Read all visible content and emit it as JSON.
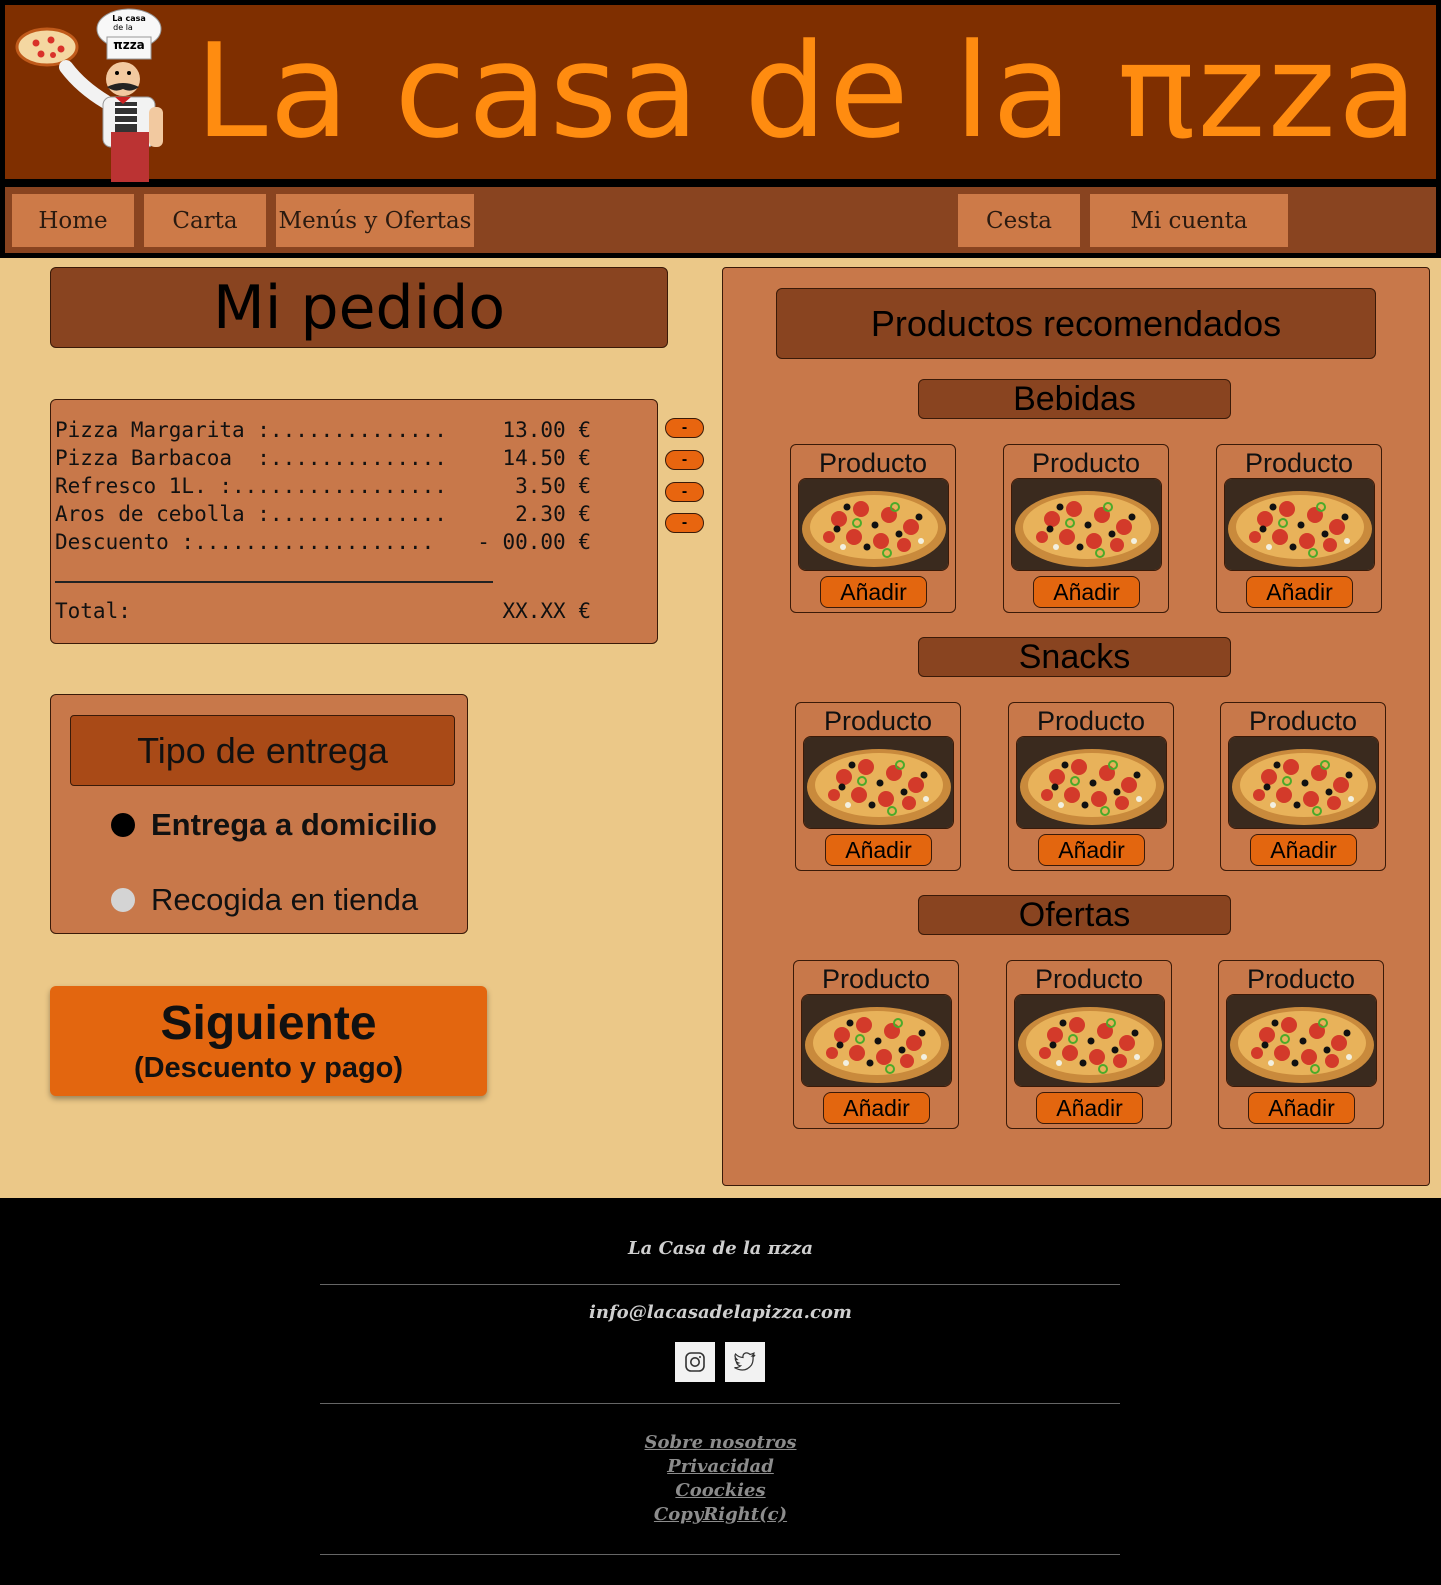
{
  "header": {
    "title": "La casa de la πzza",
    "logo_text_line1": "La casa",
    "logo_text_line2": "de la",
    "logo_text_line3": "πzza"
  },
  "nav": {
    "home": "Home",
    "carta": "Carta",
    "menus": "Menús y Ofertas",
    "cesta": "Cesta",
    "cuenta": "Mi cuenta"
  },
  "order": {
    "title": "Mi pedido",
    "lines": [
      {
        "name": "Pizza Margarita :..............",
        "value": "13.00 €"
      },
      {
        "name": "Pizza Barbacoa  :..............",
        "value": "14.50 €"
      },
      {
        "name": "Refresco 1L. :.................",
        "value": "3.50 €"
      },
      {
        "name": "Aros de cebolla :..............",
        "value": "2.30 €"
      },
      {
        "name": "Descuento :...................",
        "value": "- 00.00 €"
      }
    ],
    "total_label": "Total:",
    "total_value": "XX.XX €",
    "remove_label": "-"
  },
  "delivery": {
    "title": "Tipo de entrega",
    "options": [
      "Entrega a domicilio",
      "Recogida en tienda"
    ],
    "selected": "Entrega a domicilio"
  },
  "next": {
    "label": "Siguiente",
    "sublabel": "(Descuento y pago)"
  },
  "recommended": {
    "title": "Productos recomendados",
    "categories": [
      {
        "name": "Bebidas",
        "products": [
          "Producto",
          "Producto",
          "Producto"
        ]
      },
      {
        "name": "Snacks",
        "products": [
          "Producto",
          "Producto",
          "Producto"
        ]
      },
      {
        "name": "Ofertas",
        "products": [
          "Producto",
          "Producto",
          "Producto"
        ]
      }
    ],
    "add_label": "Añadir"
  },
  "footer": {
    "brand": "La Casa de la πzza",
    "email": "info@lacasadelapizza.com",
    "social": [
      "instagram-icon",
      "twitter-icon"
    ],
    "links": [
      "Sobre nosotros",
      "Privacidad",
      "Coockies",
      "CopyRight(c)"
    ]
  },
  "colors": {
    "header_bg": "#7f2f00",
    "title_orange": "#ff8c10",
    "nav_bg": "#894420",
    "nav_btn": "#cd7a48",
    "page_bg": "#ebc888",
    "panel": "#c8784a",
    "accent_button": "#e3660f"
  }
}
